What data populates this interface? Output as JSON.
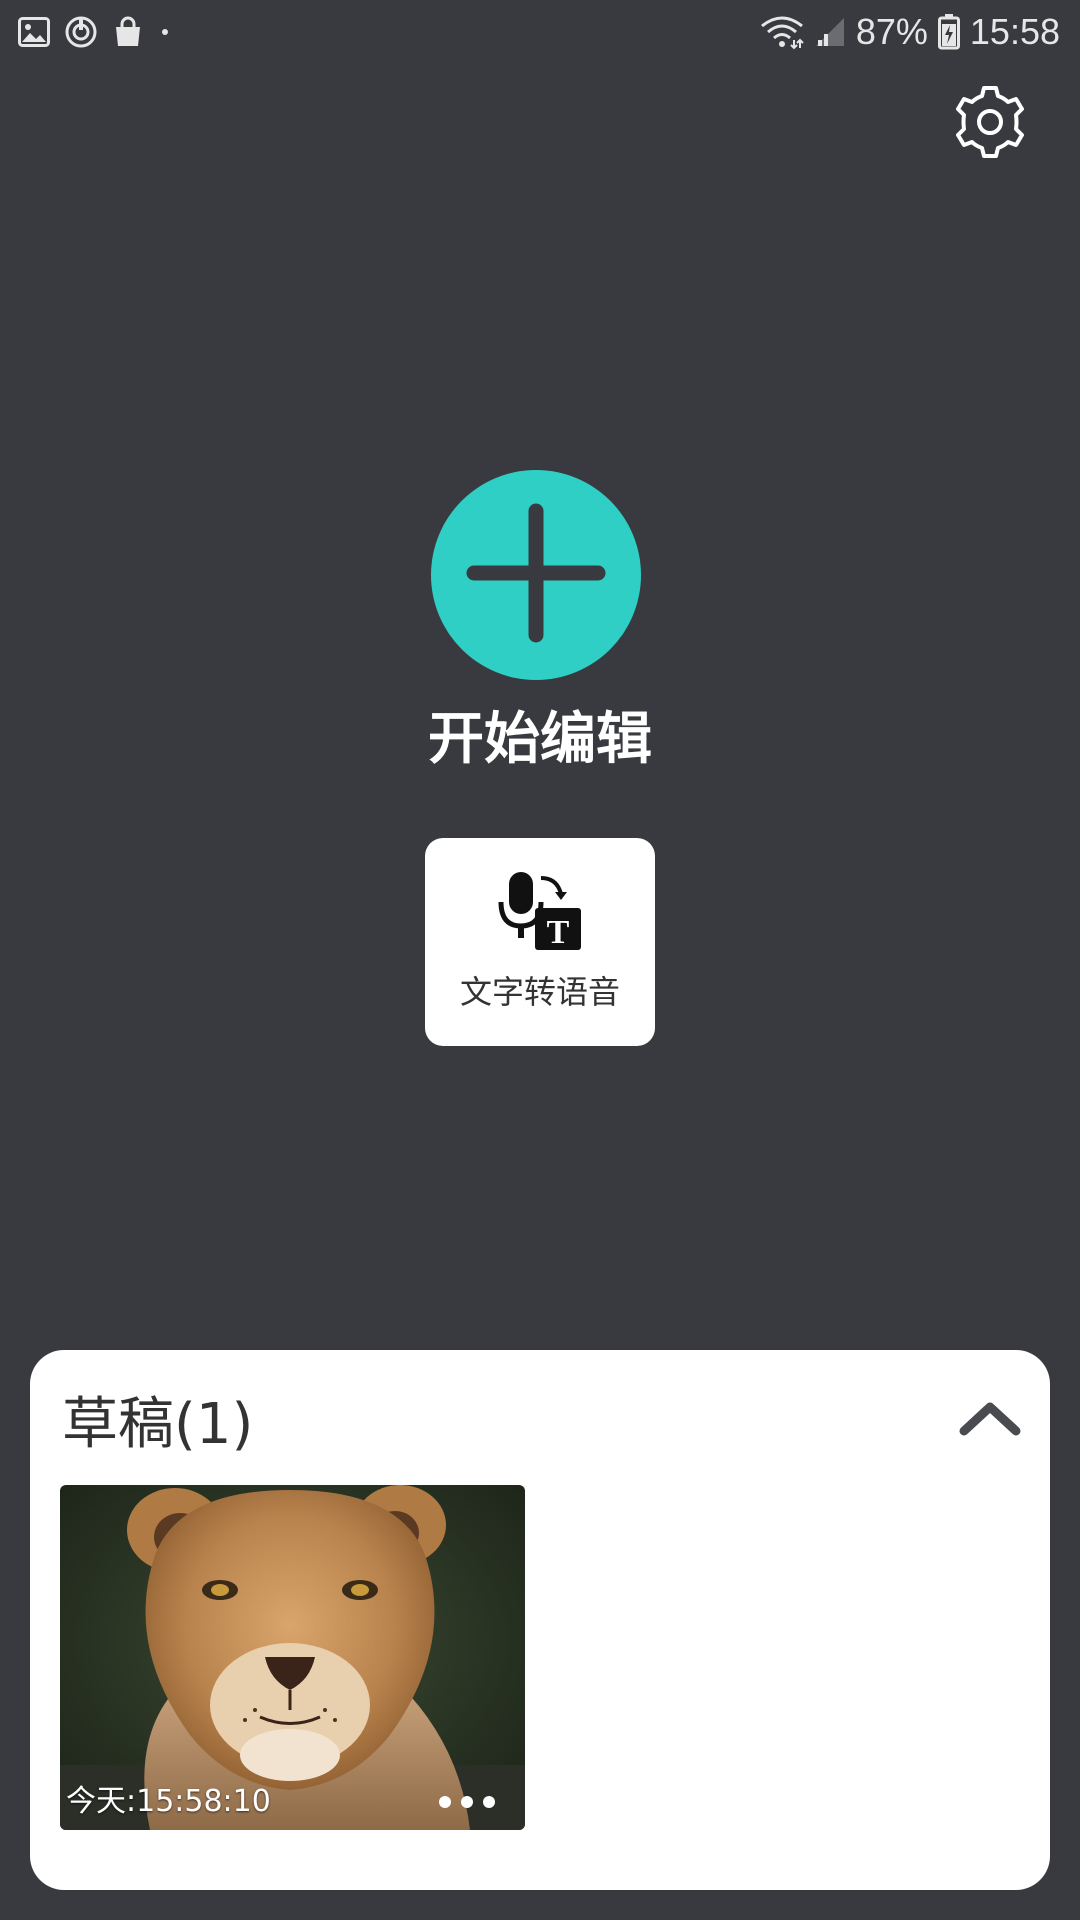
{
  "status_bar": {
    "battery": "87%",
    "time": "15:58",
    "icons": [
      "gallery-icon",
      "sync-icon",
      "shopping-bag-icon",
      "dot-icon",
      "wifi-icon",
      "cellular-signal-icon",
      "battery-charging-icon"
    ]
  },
  "settings": {
    "icon": "gear-icon"
  },
  "start_edit": {
    "label": "开始编辑",
    "icon": "plus-icon",
    "color": "#2fcfc6"
  },
  "tts": {
    "label": "文字转语音",
    "icon": "mic-to-text-icon"
  },
  "drafts": {
    "title": "草稿(1)",
    "collapse_icon": "chevron-up-icon",
    "items": [
      {
        "time": "今天:15:58:10",
        "thumbnail": "lioness-photo",
        "more_icon": "more-dots-icon"
      }
    ]
  },
  "colors": {
    "background": "#393a3f",
    "accent": "#2fcfc6",
    "panel": "#ffffff"
  }
}
